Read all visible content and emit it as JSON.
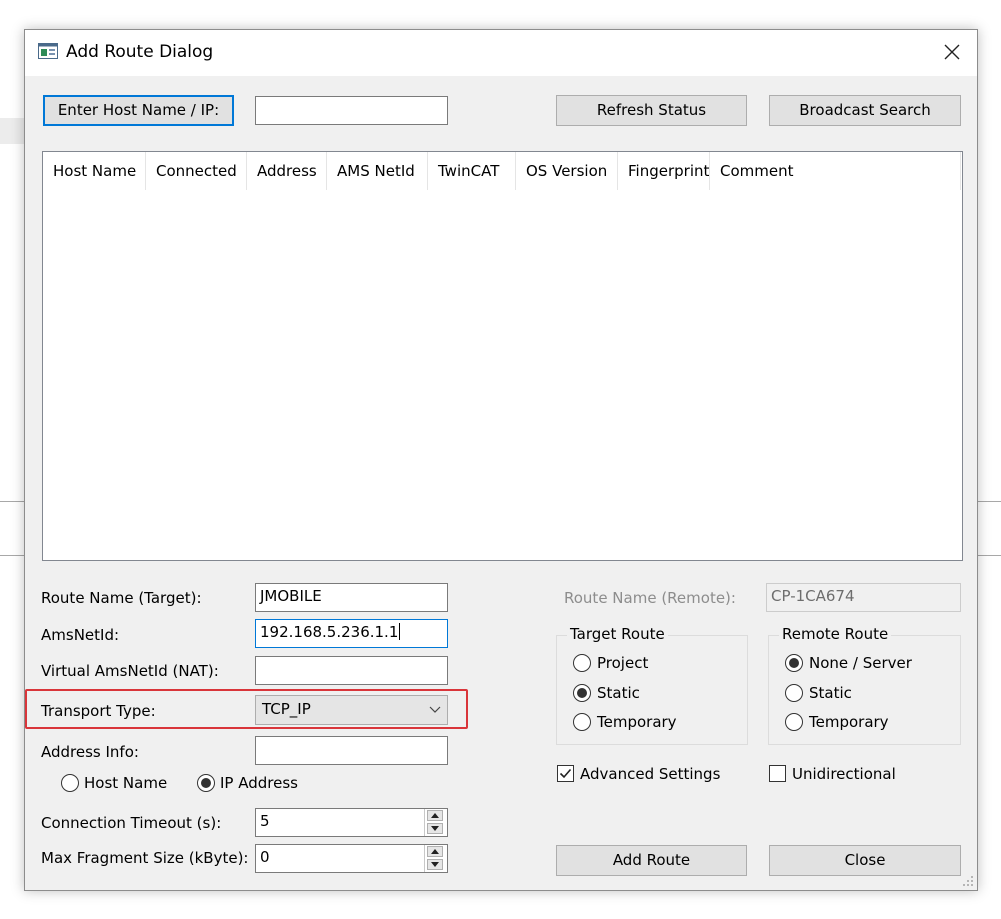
{
  "window": {
    "title": "Add Route Dialog"
  },
  "toolbar": {
    "enter_host_label": "Enter Host Name / IP:",
    "host_input_value": "",
    "refresh_label": "Refresh Status",
    "broadcast_label": "Broadcast Search"
  },
  "table": {
    "columns": [
      "Host Name",
      "Connected",
      "Address",
      "AMS NetId",
      "TwinCAT",
      "OS Version",
      "Fingerprint",
      "Comment"
    ]
  },
  "form": {
    "route_name_label": "Route Name (Target):",
    "route_name_value": "JMOBILE",
    "amsnetid_label": "AmsNetId:",
    "amsnetid_value": "192.168.5.236.1.1",
    "virtual_label": "Virtual AmsNetId (NAT):",
    "virtual_value": "",
    "transport_label": "Transport Type:",
    "transport_value": "TCP_IP",
    "address_info_label": "Address Info:",
    "address_info_value": "",
    "host_name_option": "Host Name",
    "ip_address_option": "IP Address",
    "timeout_label": "Connection Timeout (s):",
    "timeout_value": "5",
    "fragment_label": "Max Fragment Size (kByte):",
    "fragment_value": "0"
  },
  "remote": {
    "route_name_label": "Route Name (Remote):",
    "route_name_value": "CP-1CA674"
  },
  "target_route": {
    "title": "Target Route",
    "options": [
      "Project",
      "Static",
      "Temporary"
    ],
    "selected": "Static"
  },
  "remote_route": {
    "title": "Remote Route",
    "options": [
      "None / Server",
      "Static",
      "Temporary"
    ],
    "selected": "None / Server"
  },
  "options": {
    "advanced_label": "Advanced Settings",
    "advanced_checked": true,
    "unidirectional_label": "Unidirectional",
    "unidirectional_checked": false
  },
  "footer": {
    "add_route_label": "Add Route",
    "close_label": "Close"
  },
  "colors": {
    "highlight": "#d9353a",
    "focus": "#0078d7"
  }
}
